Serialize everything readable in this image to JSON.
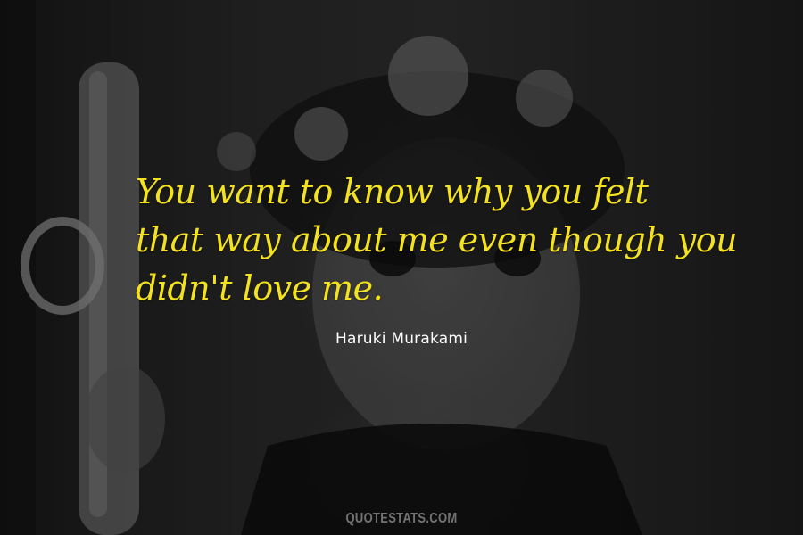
{
  "quote": {
    "lines": [
      "You want to know why you felt",
      "that way about me even though you",
      "didn't love me."
    ],
    "color": "#f4e21f"
  },
  "author": {
    "name": "Haruki Murakami",
    "color": "#ffffff"
  },
  "watermark": {
    "text": "QUOTESTATS.COM"
  }
}
